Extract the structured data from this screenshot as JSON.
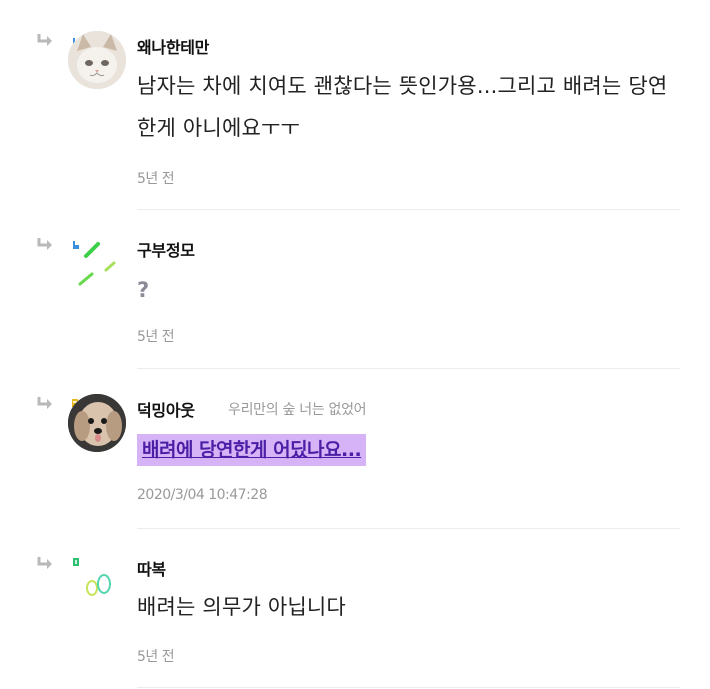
{
  "comments": [
    {
      "nickname": "왜나한테만",
      "body": "남자는 차에 치여도 괜찮다는 뜻인가용...그리고 배려는 당연한게 아니에요ㅜㅜ",
      "time": "5년 전",
      "level_color": "#3b8de0",
      "avatar_icon": "cat-face-avatar"
    },
    {
      "nickname": "구부정모",
      "body": "?",
      "time": "5년 전",
      "level_color": "#3b8de0",
      "avatar_icon": "green-dashes-avatar"
    },
    {
      "nickname": "덕밍아웃",
      "status_message": "우리만의 숲 너는 없었어",
      "link_text": "배려에 당연한게 어딨나요...",
      "time": "2020/3/04 10:47:28",
      "level_color": "#e8b61d",
      "highlight_color": "#d6b2f7",
      "avatar_icon": "dog-photo-avatar"
    },
    {
      "nickname": "따복",
      "body": "배려는 의무가 아닙니다",
      "time": "5년 전",
      "level_color": "#2fbf71",
      "avatar_icon": "green-rings-avatar"
    }
  ]
}
